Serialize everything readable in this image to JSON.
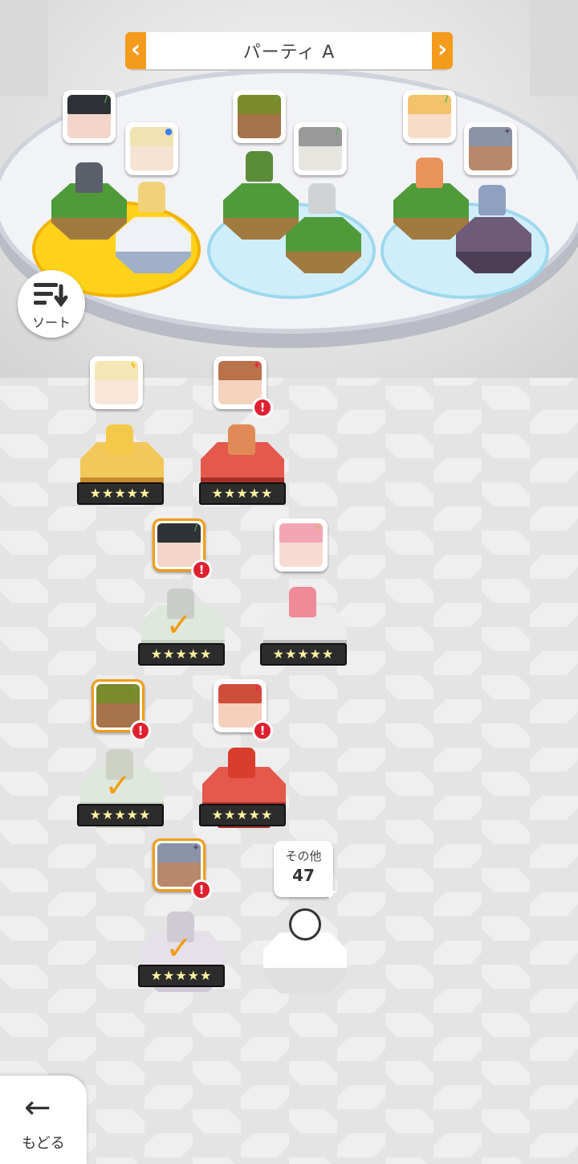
{
  "party": {
    "title": "パーティ A",
    "prev_icon": "chevron-left-icon",
    "next_icon": "chevron-right-icon"
  },
  "sort": {
    "label": "ソート",
    "icon": "sort-icon"
  },
  "others": {
    "label": "その他",
    "count": "47"
  },
  "back": {
    "label": "もどる",
    "icon": "arrow-left-icon"
  },
  "stars": {
    "text": "★★★★★"
  },
  "alert": {
    "text": "!"
  },
  "check": {
    "text": "✓"
  },
  "colors": {
    "accent": "#f39c12",
    "alert": "#e02030"
  }
}
